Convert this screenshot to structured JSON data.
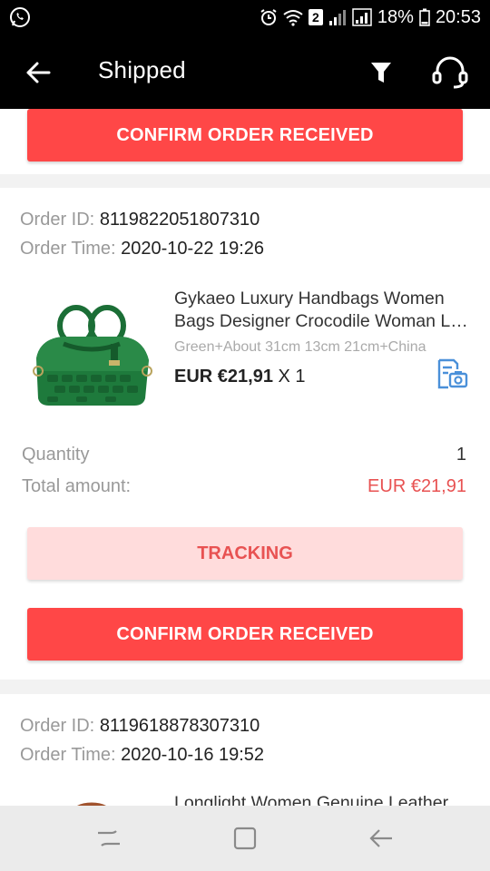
{
  "status_bar": {
    "battery": "18%",
    "time": "20:53",
    "sim_badge": "2"
  },
  "app_bar": {
    "title": "Shipped"
  },
  "top_card": {
    "confirm_label": "CONFIRM ORDER RECEIVED"
  },
  "order1": {
    "order_id_label": "Order ID:",
    "order_id": "8119822051807310",
    "order_time_label": "Order Time:",
    "order_time": "2020-10-22 19:26",
    "product_name_line1": "Gykaeo Luxury Handbags Women",
    "product_name_line2": "Bags Designer Crocodile Woman Leather Handbag",
    "product_attrs": "Green+About 31cm 13cm 21cm+China",
    "price": "EUR €21,91",
    "qty_suffix": "X 1",
    "quantity_label": "Quantity",
    "quantity_value": "1",
    "total_label": "Total amount:",
    "total_value": "EUR €21,91",
    "tracking_label": "TRACKING",
    "confirm_label": "CONFIRM ORDER RECEIVED"
  },
  "order2": {
    "order_id_label": "Order ID:",
    "order_id": "8119618878307310",
    "order_time_label": "Order Time:",
    "order_time": "2020-10-16 19:52",
    "product_name_line1": "Longlight Women Genuine Leather"
  },
  "colors": {
    "primary_red": "#ff4747",
    "tracking_bg": "#ffdcdc",
    "bag_green": "#1e7a3c"
  }
}
